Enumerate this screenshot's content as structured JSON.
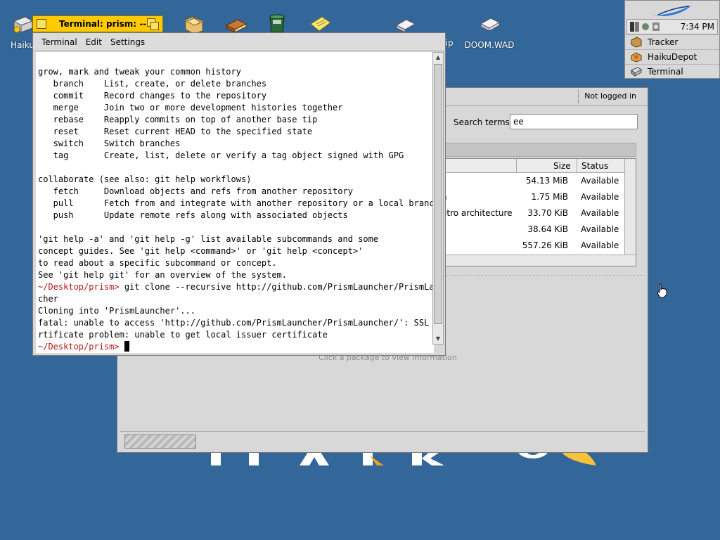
{
  "desktop": {
    "icons": [
      {
        "label": "Haiku",
        "icon": "disk-icon"
      },
      {
        "label": "",
        "icon": "folder-icon"
      },
      {
        "label": "",
        "icon": "book-icon"
      },
      {
        "label": "",
        "icon": "trash-icon"
      },
      {
        "label": "",
        "icon": "note-icon"
      },
      {
        "label": "zip",
        "icon": "zip-icon"
      },
      {
        "label": "DOOM.WAD",
        "icon": "wad-icon"
      }
    ]
  },
  "deskbar": {
    "clock": "7:34 PM",
    "items": [
      {
        "label": "Tracker",
        "icon": "tracker-icon"
      },
      {
        "label": "HaikuDepot",
        "icon": "haikudepot-icon"
      },
      {
        "label": "Terminal",
        "icon": "terminal-icon"
      }
    ]
  },
  "depot": {
    "login_status": "Not logged in",
    "search_label": "Search terms:",
    "search_value": "ee",
    "columns": {
      "size": "Size",
      "status": "Status"
    },
    "rows": [
      {
        "name": "",
        "size": "54.13 MiB",
        "status": "Available"
      },
      {
        "name": "n",
        "size": "1.75 MiB",
        "status": "Available"
      },
      {
        "name": "etro architecture",
        "size": "33.70 KiB",
        "status": "Available"
      },
      {
        "name": "",
        "size": "38.64 KiB",
        "status": "Available"
      },
      {
        "name": "",
        "size": "557.26 KiB",
        "status": "Available"
      }
    ],
    "hint": "Click a package to view information"
  },
  "terminal": {
    "title": "Terminal: prism: --",
    "menu": [
      "Terminal",
      "Edit",
      "Settings"
    ],
    "lines": [
      {
        "text": "grow, mark and tweak your common history"
      },
      {
        "text": "   branch    List, create, or delete branches"
      },
      {
        "text": "   commit    Record changes to the repository"
      },
      {
        "text": "   merge     Join two or more development histories together"
      },
      {
        "text": "   rebase    Reapply commits on top of another base tip"
      },
      {
        "text": "   reset     Reset current HEAD to the specified state"
      },
      {
        "text": "   switch    Switch branches"
      },
      {
        "text": "   tag       Create, list, delete or verify a tag object signed with GPG"
      },
      {
        "text": ""
      },
      {
        "text": "collaborate (see also: git help workflows)"
      },
      {
        "text": "   fetch     Download objects and refs from another repository"
      },
      {
        "text": "   pull      Fetch from and integrate with another repository or a local branch"
      },
      {
        "text": "   push      Update remote refs along with associated objects"
      },
      {
        "text": ""
      },
      {
        "text": "'git help -a' and 'git help -g' list available subcommands and some"
      },
      {
        "text": "concept guides. See 'git help <command>' or 'git help <concept>'"
      },
      {
        "text": "to read about a specific subcommand or concept."
      },
      {
        "text": "See 'git help git' for an overview of the system."
      },
      {
        "prompt": "~/Desktop/prism>",
        "text": " git clone --recursive http://github.com/PrismLauncher/PrismLaun"
      },
      {
        "text": "cher"
      },
      {
        "text": "Cloning into 'PrismLauncher'..."
      },
      {
        "text": "fatal: unable to access 'http://github.com/PrismLauncher/PrismLauncher/': SSL ce"
      },
      {
        "text": "rtificate problem: unable to get local issuer certificate"
      },
      {
        "prompt": "~/Desktop/prism>",
        "text": " ",
        "cursor": true
      }
    ]
  }
}
